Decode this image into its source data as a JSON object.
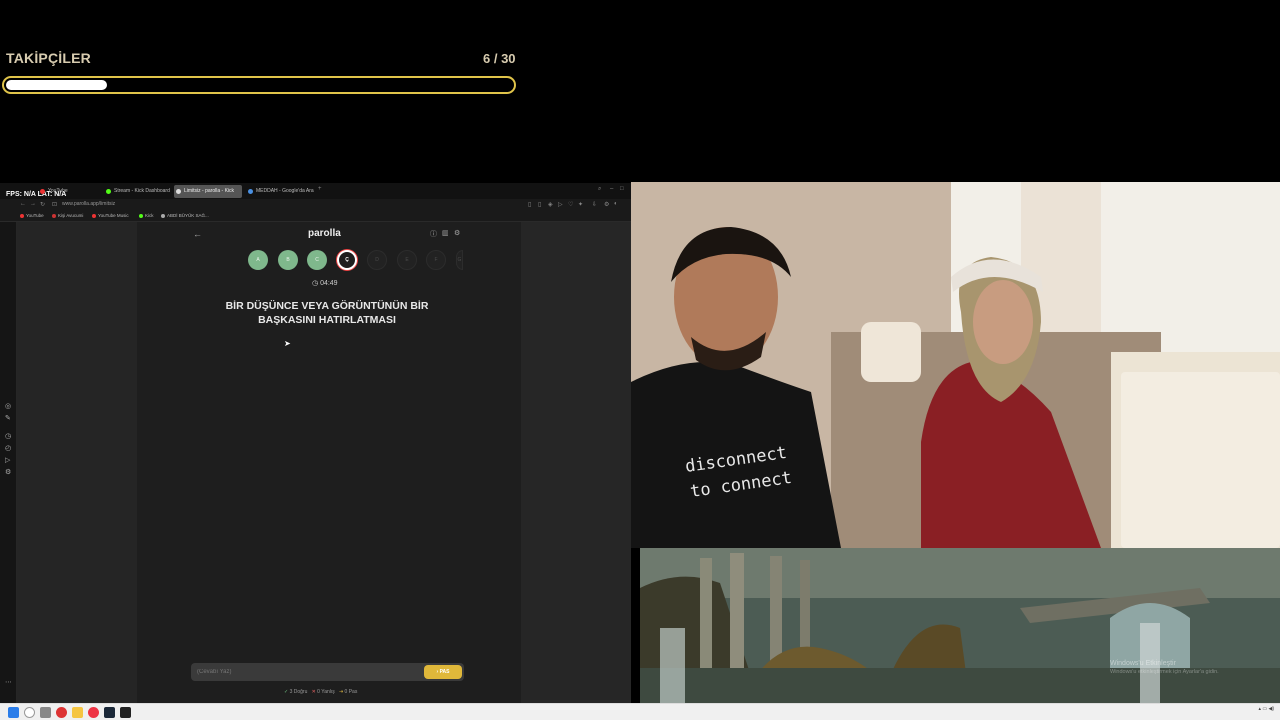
{
  "overlay": {
    "title": "TAKİPÇİLER",
    "count_text": "6 / 30",
    "progress": 0.2
  },
  "browser": {
    "fps_text": "FPS: N/A  LAT: N/A",
    "tabs": [
      "YouTube",
      "Stream - Kick Dashboard",
      "Limitsiz - parolla - Kick",
      "MEDDAH - Google'da Ara"
    ],
    "url": "www.parolla.app/limitsiz",
    "bookmarks": [
      "YouTube",
      "Kişi Avucumi",
      "YouTube Music",
      "Kick",
      "ABDİ BÜYÜK SAĞ..."
    ]
  },
  "game": {
    "title": "parolla",
    "letters": [
      {
        "label": "A",
        "state": "done"
      },
      {
        "label": "B",
        "state": "done"
      },
      {
        "label": "C",
        "state": "done"
      },
      {
        "label": "Ç",
        "state": "current"
      },
      {
        "label": "D",
        "state": "todo"
      },
      {
        "label": "E",
        "state": "todo"
      },
      {
        "label": "F",
        "state": "todo"
      },
      {
        "label": "G",
        "state": "todo"
      }
    ],
    "timer": "04:49",
    "question": "BİR DÜŞÜNCE VEYA GÖRÜNTÜNÜN BİR BAŞKASINI HATIRLATMASI",
    "answer_placeholder": "(Cevabı Yaz)",
    "pass_label": "PAS",
    "stats": {
      "correct": "3 Doğru",
      "wrong": "0 Yanlış",
      "pass": "0 Pas"
    }
  },
  "webcam": {
    "shirt_text_line1": "disconnect",
    "shirt_text_line2": "to connect"
  },
  "desktop": {
    "watermark_title": "Windows'u Etkinleştir",
    "watermark_sub": "Windows'u etkinleştirmek için Ayarlar'a gidin."
  },
  "colors": {
    "accent_gold": "#e0c44a",
    "done_green": "#7fb88c",
    "pass_yellow": "#e0b83a"
  }
}
